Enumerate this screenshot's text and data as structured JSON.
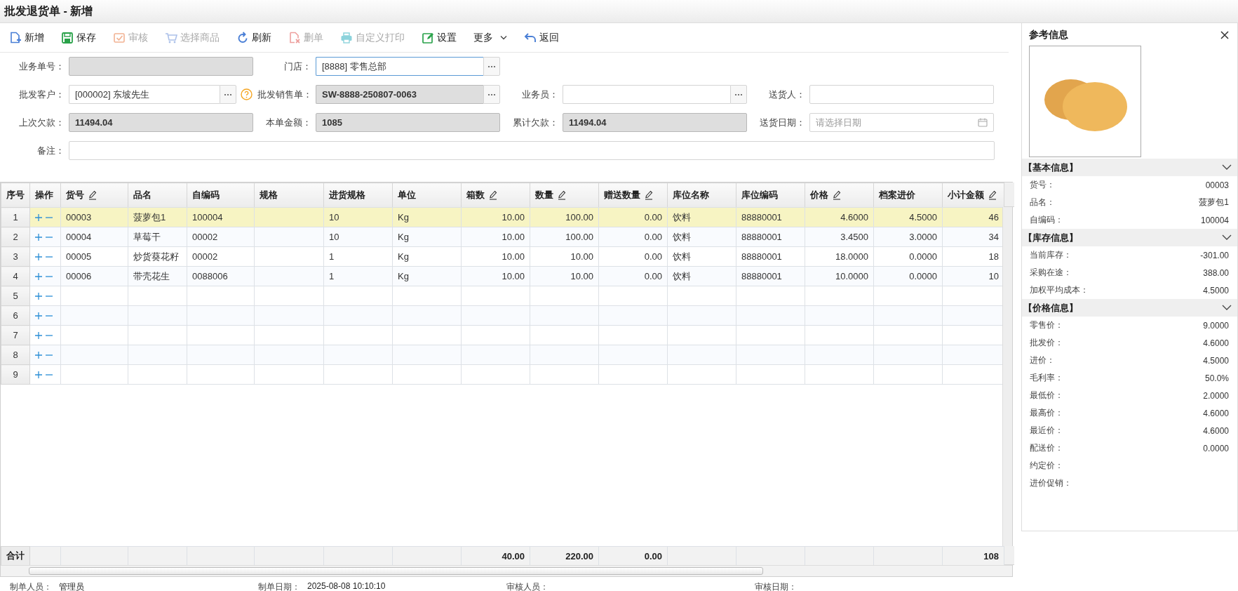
{
  "window": {
    "title": "批发退货单 - 新增"
  },
  "toolbar": [
    {
      "kind": "new",
      "label": "新增",
      "disabled": false
    },
    {
      "kind": "save",
      "label": "保存",
      "disabled": false
    },
    {
      "kind": "audit",
      "label": "审核",
      "disabled": true
    },
    {
      "kind": "cart",
      "label": "选择商品",
      "disabled": true
    },
    {
      "kind": "refresh",
      "label": "刷新",
      "disabled": false
    },
    {
      "kind": "delete",
      "label": "删单",
      "disabled": true
    },
    {
      "kind": "print",
      "label": "自定义打印",
      "disabled": true
    },
    {
      "kind": "settings",
      "label": "设置",
      "disabled": false
    },
    {
      "kind": "more",
      "label": "更多",
      "disabled": false
    },
    {
      "kind": "back",
      "label": "返回",
      "disabled": false
    }
  ],
  "form": {
    "fields": [
      {
        "kind": "text",
        "label": "业务单号：",
        "readonly": true,
        "focused": false
      },
      {
        "kind": "picker",
        "label": "门店：",
        "value": "[8888] 零售总部",
        "readonly": false,
        "focused": true
      },
      {
        "kind": "empty"
      },
      {
        "kind": "empty"
      },
      {
        "kind": "picker",
        "label": "批发客户：",
        "value": "[000002] 东坡先生",
        "readonly": false,
        "focused": false,
        "help": true
      },
      {
        "kind": "picker",
        "label": "批发销售单：",
        "value": "SW-8888-250807-0063",
        "readonly": true,
        "focused": false
      },
      {
        "kind": "picker",
        "label": "业务员：",
        "readonly": false,
        "focused": false
      },
      {
        "kind": "text",
        "label": "送货人：",
        "readonly": false,
        "focused": false
      },
      {
        "kind": "text",
        "label": "上次欠款：",
        "value": "11494.04",
        "readonly": true,
        "focused": false
      },
      {
        "kind": "text",
        "label": "本单金额：",
        "value": "1085",
        "readonly": true,
        "focused": false
      },
      {
        "kind": "text",
        "label": "累计欠款：",
        "value": "11494.04",
        "readonly": true,
        "focused": false
      },
      {
        "kind": "date",
        "label": "送货日期：",
        "placeholder": "请选择日期",
        "readonly": false,
        "focused": false
      }
    ],
    "remark": {
      "label": "备注："
    }
  },
  "table": {
    "columns": [
      {
        "kind": "index",
        "label": "序号",
        "editable": false,
        "total": "合计"
      },
      {
        "kind": "actions",
        "label": "操作",
        "editable": false
      },
      {
        "kind": "text",
        "label": "货号",
        "editable": true
      },
      {
        "kind": "text",
        "label": "品名",
        "editable": false
      },
      {
        "kind": "text",
        "label": "自编码",
        "editable": false
      },
      {
        "kind": "text",
        "label": "规格",
        "editable": false
      },
      {
        "kind": "text",
        "label": "进货规格",
        "editable": false
      },
      {
        "kind": "text",
        "label": "单位",
        "editable": false
      },
      {
        "kind": "number",
        "label": "箱数",
        "editable": true,
        "total": "40.00"
      },
      {
        "kind": "number",
        "label": "数量",
        "editable": true,
        "total": "220.00"
      },
      {
        "kind": "number",
        "label": "赠送数量",
        "editable": true,
        "total": "0.00"
      },
      {
        "kind": "text",
        "label": "库位名称",
        "editable": false
      },
      {
        "kind": "text",
        "label": "库位编码",
        "editable": false
      },
      {
        "kind": "number",
        "label": "价格",
        "editable": true
      },
      {
        "kind": "number",
        "label": "档案进价",
        "editable": false
      },
      {
        "kind": "number",
        "label": "小计金额",
        "editable": true,
        "total": "108"
      }
    ],
    "rows": [
      {
        "index": "1",
        "selected": true,
        "cells": [
          {
            "text": "00003"
          },
          {
            "text": "菠萝包1"
          },
          {
            "text": "100004"
          },
          {},
          {
            "text": "10"
          },
          {
            "text": "Kg"
          },
          {
            "text": "10.00"
          },
          {
            "text": "100.00"
          },
          {
            "text": "0.00"
          },
          {
            "text": "饮料"
          },
          {
            "text": "88880001"
          },
          {
            "text": "4.6000"
          },
          {
            "text": "4.5000"
          },
          {
            "text": "46"
          }
        ]
      },
      {
        "index": "2",
        "selected": false,
        "cells": [
          {
            "text": "00004"
          },
          {
            "text": "草莓干"
          },
          {
            "text": "00002"
          },
          {},
          {
            "text": "10"
          },
          {
            "text": "Kg"
          },
          {
            "text": "10.00"
          },
          {
            "text": "100.00"
          },
          {
            "text": "0.00"
          },
          {
            "text": "饮料"
          },
          {
            "text": "88880001"
          },
          {
            "text": "3.4500"
          },
          {
            "text": "3.0000"
          },
          {
            "text": "34"
          }
        ]
      },
      {
        "index": "3",
        "selected": false,
        "cells": [
          {
            "text": "00005"
          },
          {
            "text": "炒货葵花籽"
          },
          {
            "text": "00002"
          },
          {},
          {
            "text": "1"
          },
          {
            "text": "Kg"
          },
          {
            "text": "10.00"
          },
          {
            "text": "10.00"
          },
          {
            "text": "0.00"
          },
          {
            "text": "饮料"
          },
          {
            "text": "88880001"
          },
          {
            "text": "18.0000"
          },
          {
            "text": "0.0000"
          },
          {
            "text": "18"
          }
        ]
      },
      {
        "index": "4",
        "selected": false,
        "cells": [
          {
            "text": "00006"
          },
          {
            "text": "带壳花生"
          },
          {
            "text": "0088006"
          },
          {},
          {
            "text": "1"
          },
          {
            "text": "Kg"
          },
          {
            "text": "10.00"
          },
          {
            "text": "10.00"
          },
          {
            "text": "0.00"
          },
          {
            "text": "饮料"
          },
          {
            "text": "88880001"
          },
          {
            "text": "10.0000"
          },
          {
            "text": "0.0000"
          },
          {
            "text": "10"
          }
        ]
      },
      {
        "index": "5",
        "selected": false
      },
      {
        "index": "6",
        "selected": false
      },
      {
        "index": "7",
        "selected": false
      },
      {
        "index": "8",
        "selected": false
      },
      {
        "index": "9",
        "selected": false
      }
    ]
  },
  "footer": [
    {
      "label": "制单人员：",
      "value": "管理员"
    },
    {
      "label": "制单日期：",
      "value": "2025-08-08 10:10:10"
    },
    {
      "label": "审核人员："
    },
    {
      "label": "审核日期："
    }
  ],
  "panel": {
    "title": "参考信息",
    "sections": [
      {
        "title": "【基本信息】",
        "expanded": true,
        "rows": [
          {
            "label": "货号：",
            "value": "00003"
          },
          {
            "label": "品名：",
            "value": "菠萝包1"
          },
          {
            "label": "自编码：",
            "value": "100004"
          }
        ]
      },
      {
        "title": "【库存信息】",
        "expanded": true,
        "rows": [
          {
            "label": "当前库存：",
            "value": "-301.00"
          },
          {
            "label": "采购在途：",
            "value": "388.00"
          },
          {
            "label": "加权平均成本：",
            "value": "4.5000"
          }
        ]
      },
      {
        "title": "【价格信息】",
        "expanded": true,
        "rows": [
          {
            "label": "零售价：",
            "value": "9.0000"
          },
          {
            "label": "批发价：",
            "value": "4.6000"
          },
          {
            "label": "进价：",
            "value": "4.5000"
          },
          {
            "label": "毛利率：",
            "value": "50.0%"
          },
          {
            "label": "最低价：",
            "value": "2.0000"
          },
          {
            "label": "最高价：",
            "value": "4.6000"
          },
          {
            "label": "最近价：",
            "value": "4.6000"
          },
          {
            "label": "配送价：",
            "value": "0.0000"
          },
          {
            "label": "约定价："
          },
          {
            "label": "进价促销："
          }
        ]
      }
    ]
  }
}
